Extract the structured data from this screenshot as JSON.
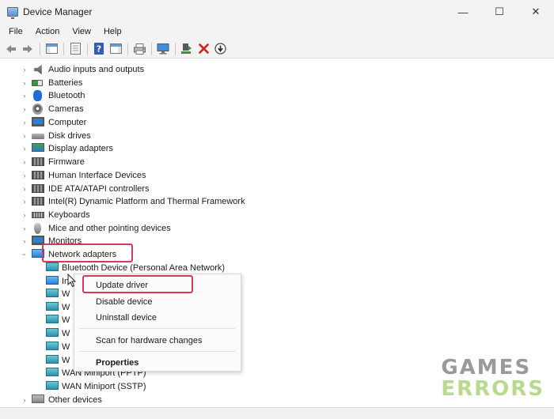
{
  "window": {
    "title": "Device Manager",
    "minimize": "—",
    "maximize": "☐",
    "close": "✕"
  },
  "menu": [
    "File",
    "Action",
    "View",
    "Help"
  ],
  "toolbar": [
    "back",
    "forward",
    "show-hide-console-tree",
    "properties",
    "help",
    "show-hide-action-pane",
    "print",
    "export-list",
    "scan-hardware",
    "update-driver",
    "uninstall-device",
    "disable-device"
  ],
  "tree": {
    "categories": [
      {
        "label": "Audio inputs and outputs",
        "icon": "speaker-icon",
        "expanded": false
      },
      {
        "label": "Batteries",
        "icon": "battery-icon",
        "expanded": false
      },
      {
        "label": "Bluetooth",
        "icon": "bluetooth-icon",
        "expanded": false
      },
      {
        "label": "Cameras",
        "icon": "camera-icon",
        "expanded": false
      },
      {
        "label": "Computer",
        "icon": "computer-icon",
        "expanded": false
      },
      {
        "label": "Disk drives",
        "icon": "disk-drive-icon",
        "expanded": false
      },
      {
        "label": "Display adapters",
        "icon": "display-adapter-icon",
        "expanded": false
      },
      {
        "label": "Firmware",
        "icon": "firmware-icon",
        "expanded": false
      },
      {
        "label": "Human Interface Devices",
        "icon": "hid-icon",
        "expanded": false
      },
      {
        "label": "IDE ATA/ATAPI controllers",
        "icon": "ide-controller-icon",
        "expanded": false
      },
      {
        "label": "Intel(R) Dynamic Platform and Thermal Framework",
        "icon": "chip-icon",
        "expanded": false
      },
      {
        "label": "Keyboards",
        "icon": "keyboard-icon",
        "expanded": false
      },
      {
        "label": "Mice and other pointing devices",
        "icon": "mouse-icon",
        "expanded": false
      },
      {
        "label": "Monitors",
        "icon": "monitor-icon",
        "expanded": false
      },
      {
        "label": "Network adapters",
        "icon": "network-adapter-icon",
        "expanded": true
      }
    ],
    "network_children": [
      "Bluetooth Device (Personal Area Network)",
      "In",
      "W",
      "W",
      "W",
      "W",
      "W",
      "W",
      "WAN Miniport (PPTP)",
      "WAN Miniport (SSTP)"
    ],
    "next_category": "Other devices"
  },
  "context_menu": {
    "items": [
      "Update driver",
      "Disable device",
      "Uninstall device",
      "Scan for hardware changes",
      "Properties"
    ]
  },
  "watermark": {
    "line1": "GAMES",
    "line2": "ERRORS"
  },
  "colors": {
    "highlight": "#d63a5a",
    "accent": "#2f7fd5"
  }
}
